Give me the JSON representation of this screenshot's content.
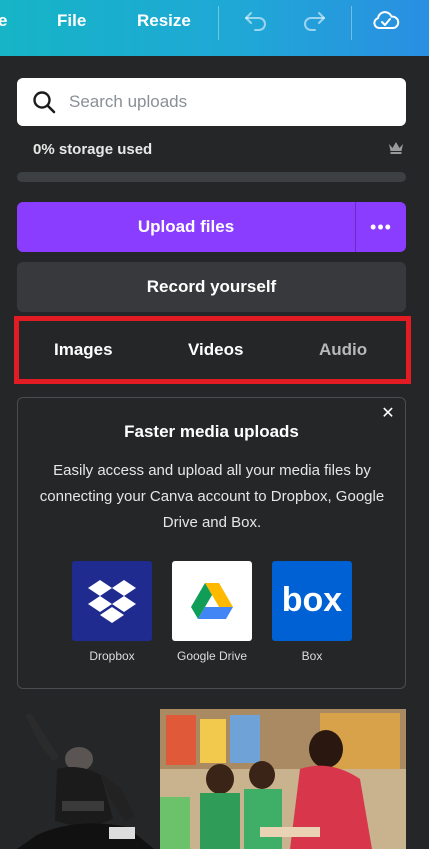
{
  "topbar": {
    "partial_item": "e",
    "file_label": "File",
    "resize_label": "Resize",
    "icons": [
      "undo-icon",
      "redo-icon",
      "cloud-saved-icon"
    ]
  },
  "search": {
    "placeholder": "Search uploads"
  },
  "storage": {
    "text": "0% storage used",
    "fraction": 0.0
  },
  "upload": {
    "label": "Upload files",
    "more": "•••"
  },
  "record": {
    "label": "Record yourself"
  },
  "tabs": [
    {
      "label": "Images"
    },
    {
      "label": "Videos"
    },
    {
      "label": "Audio"
    }
  ],
  "card": {
    "close": "✕",
    "title": "Faster media uploads",
    "body": "Easily access and upload all your media files by connecting your Canva account to Dropbox, Google Drive and Box.",
    "services": [
      {
        "label": "Dropbox",
        "color": "#1f2b8f"
      },
      {
        "label": "Google Drive",
        "color": "#ffffff"
      },
      {
        "label": "Box",
        "color": "#0061d5"
      }
    ]
  },
  "colors": {
    "accent": "#8b3dff",
    "highlight": "#e31b23",
    "background": "#252627"
  }
}
